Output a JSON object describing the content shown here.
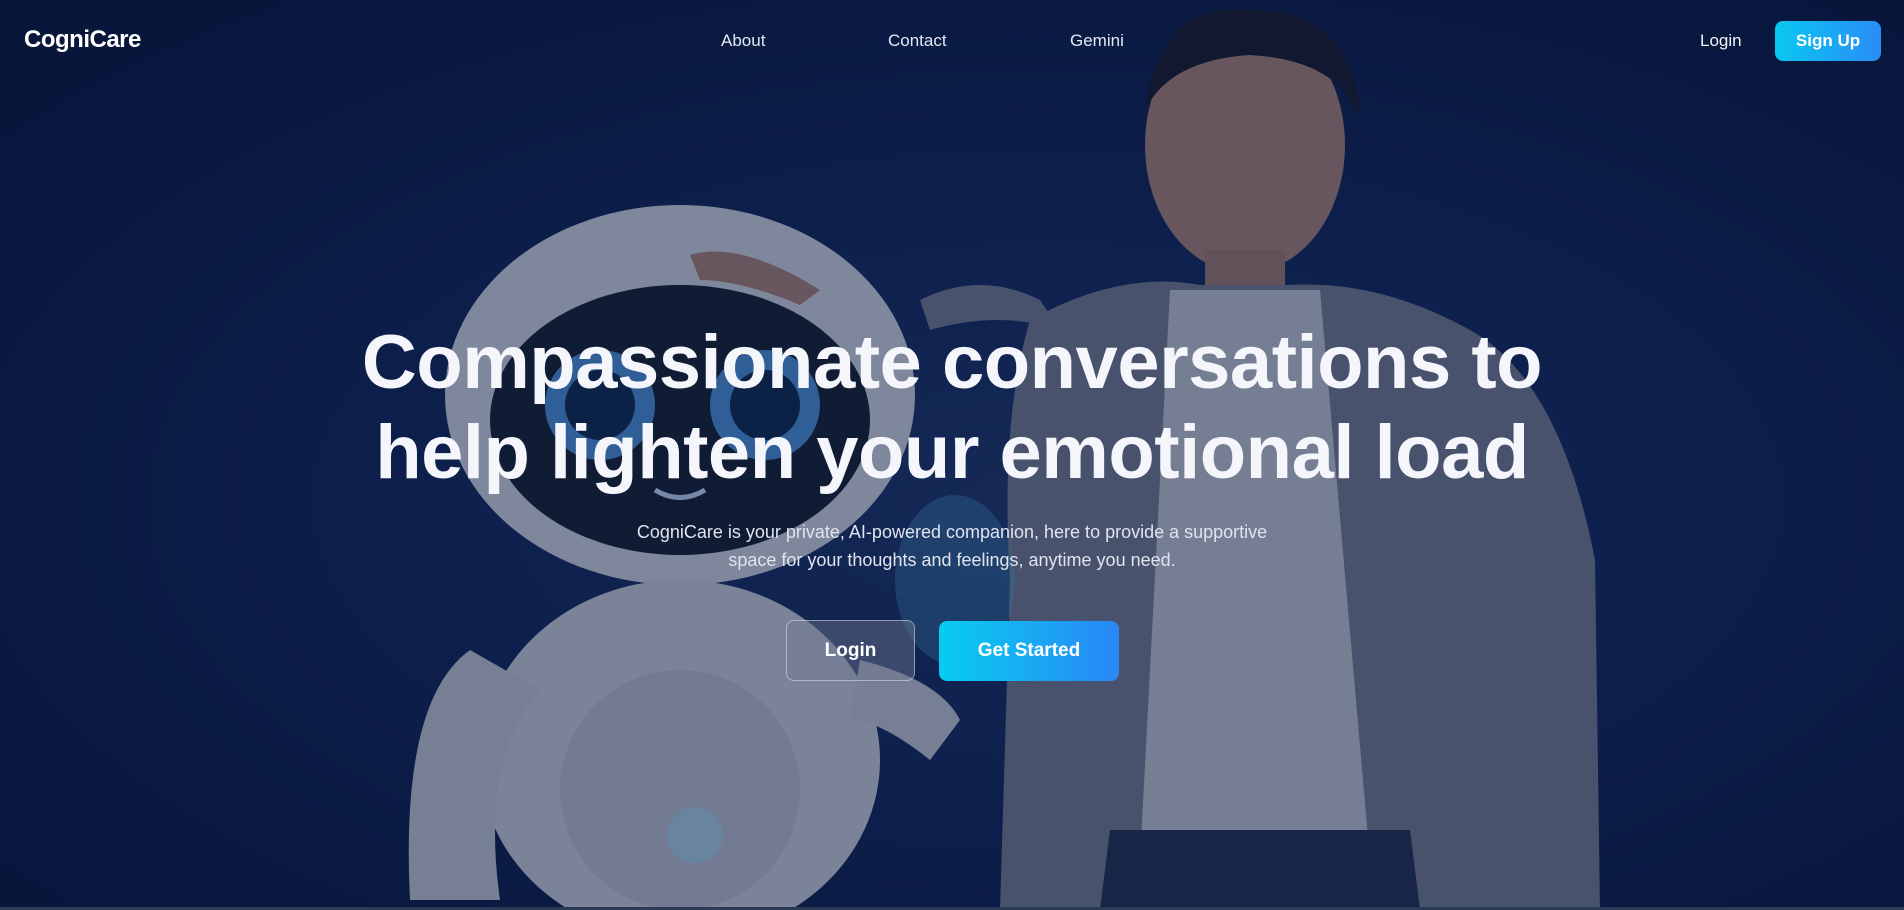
{
  "nav": {
    "brand": "CogniCare",
    "links": [
      {
        "label": "About"
      },
      {
        "label": "Contact"
      },
      {
        "label": "Gemini"
      }
    ],
    "login_label": "Login",
    "signup_label": "Sign Up"
  },
  "hero": {
    "headline_lines": [
      "Compassionate conversations to",
      "help lighten your emotional load"
    ],
    "subtext_lines": [
      "CogniCare is your private, AI-powered companion, here to provide a supportive",
      "space for your thoughts and feelings, anytime you need."
    ],
    "login_label": "Login",
    "get_started_label": "Get Started",
    "background_image": "robot-and-person-illustration"
  },
  "colors": {
    "accent_start": "#07cdf0",
    "accent_end": "#2a87f6",
    "background": "#0b1a3c"
  }
}
